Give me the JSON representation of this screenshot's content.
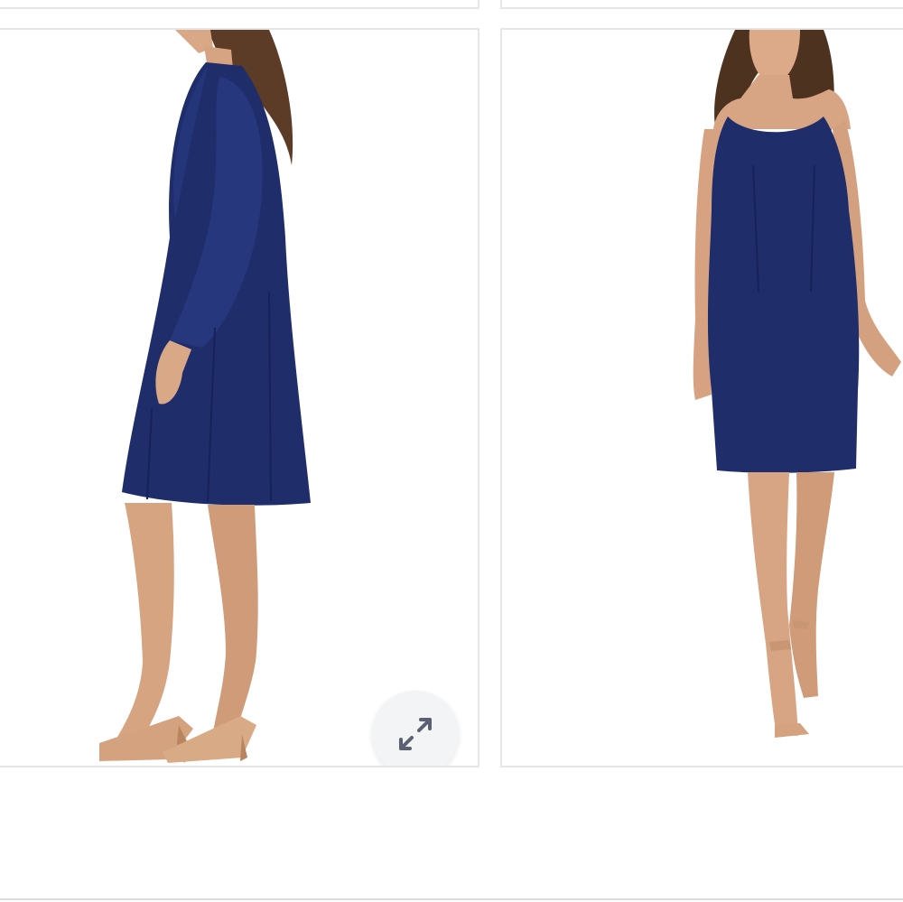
{
  "gallery": {
    "images": [
      {
        "icon": "product-photo-side-view",
        "alt": ""
      },
      {
        "icon": "product-photo-front-view",
        "alt": ""
      }
    ],
    "expand_button": {
      "icon": "expand-icon"
    }
  },
  "colors": {
    "border": "#e6e6e6",
    "navy": "#1f2d6b",
    "skin": "#d9a887",
    "button_bg": "#f3f4f6",
    "icon": "#5b6170"
  }
}
